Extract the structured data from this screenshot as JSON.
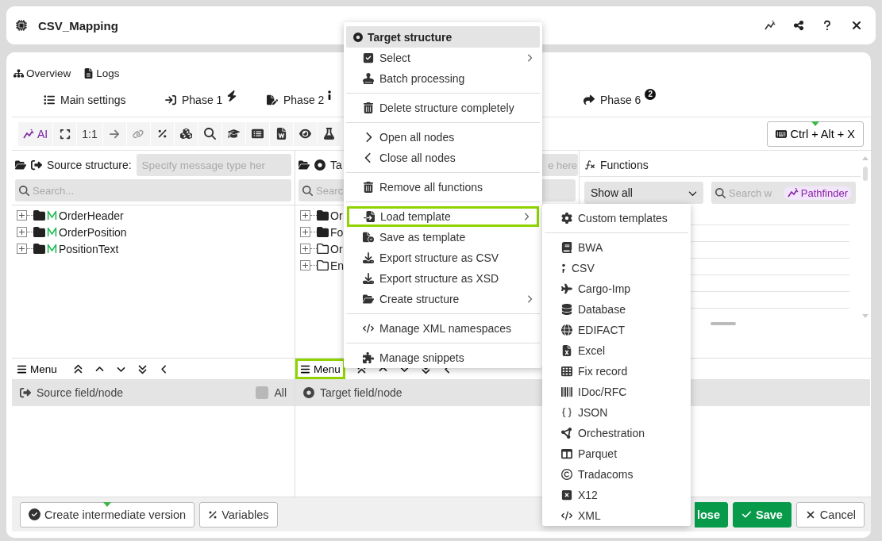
{
  "window": {
    "title": "CSV_Mapping"
  },
  "top_links": [
    {
      "label": "Overview"
    },
    {
      "label": "Logs"
    }
  ],
  "phase_tabs": [
    {
      "label": "Main settings"
    },
    {
      "label": "Phase 1"
    },
    {
      "label": "Phase 2"
    },
    {
      "label": "Phase 6",
      "count": "2"
    }
  ],
  "toolbar": {
    "ai_label": "AI",
    "ratio_label": "1:1",
    "shortcut": "Ctrl + Alt + X"
  },
  "source": {
    "title": "Source structure:",
    "type_placeholder": "Specify message type her",
    "search_placeholder": "Search...",
    "nodes": [
      {
        "label": "OrderHeader"
      },
      {
        "label": "OrderPosition"
      },
      {
        "label": "PositionText"
      }
    ]
  },
  "target": {
    "title": "Ta",
    "type_placeholder": "e here",
    "search_placeholder": "Searc",
    "nodes": [
      {
        "label": "Or",
        "filled": true
      },
      {
        "label": "Fo",
        "filled": true
      },
      {
        "label": "Or",
        "filled": false
      },
      {
        "label": "En",
        "filled": false
      }
    ]
  },
  "functions": {
    "title": "Functions",
    "filter": "Show all",
    "search_placeholder": "Search w",
    "badge": "Pathfinder"
  },
  "lower": {
    "source_menu": {
      "label": "Menu",
      "selected": false
    },
    "target_menu": {
      "label": "Menu",
      "selected": true
    },
    "source_header": "Source field/node",
    "all_checkbox": {
      "label": "All",
      "checked": false
    },
    "target_header": "Target field/node"
  },
  "footer": {
    "left": [
      {
        "label": "Create intermediate version"
      },
      {
        "label": "Variables"
      }
    ],
    "right": [
      {
        "label": "lose",
        "kind": "primary"
      },
      {
        "label": "Save",
        "kind": "primary"
      },
      {
        "label": "Cancel",
        "kind": "plain"
      }
    ]
  },
  "context_menu": {
    "title": "Target structure",
    "groups": [
      [
        {
          "label": "Select",
          "submenu": true,
          "selected": false
        },
        {
          "label": "Batch processing",
          "submenu": false,
          "selected": false
        }
      ],
      [
        {
          "label": "Delete structure completely",
          "submenu": false,
          "selected": false
        }
      ],
      [
        {
          "label": "Open all nodes",
          "submenu": false,
          "selected": false
        },
        {
          "label": "Close all nodes",
          "submenu": false,
          "selected": false
        }
      ],
      [
        {
          "label": "Remove all functions",
          "submenu": false,
          "selected": false
        }
      ],
      [
        {
          "label": "Load template",
          "submenu": true,
          "selected": true
        },
        {
          "label": "Save as template",
          "submenu": false,
          "selected": false
        },
        {
          "label": "Export structure as CSV",
          "submenu": false,
          "selected": false
        },
        {
          "label": "Export structure as XSD",
          "submenu": false,
          "selected": false
        },
        {
          "label": "Create structure",
          "submenu": true,
          "selected": false
        }
      ],
      [
        {
          "label": "Manage XML namespaces",
          "submenu": false,
          "selected": false
        }
      ],
      [
        {
          "label": "Manage snippets",
          "submenu": false,
          "selected": false
        }
      ]
    ]
  },
  "submenu": {
    "groups": [
      [
        {
          "label": "Custom templates"
        }
      ],
      [
        {
          "label": "BWA"
        },
        {
          "label": "CSV"
        },
        {
          "label": "Cargo-Imp"
        },
        {
          "label": "Database"
        },
        {
          "label": "EDIFACT"
        },
        {
          "label": "Excel"
        },
        {
          "label": "Fix record"
        },
        {
          "label": "IDoc/RFC"
        },
        {
          "label": "JSON"
        },
        {
          "label": "Orchestration"
        },
        {
          "label": "Parquet"
        },
        {
          "label": "Tradacoms"
        },
        {
          "label": "X12"
        },
        {
          "label": "XML"
        }
      ]
    ]
  }
}
